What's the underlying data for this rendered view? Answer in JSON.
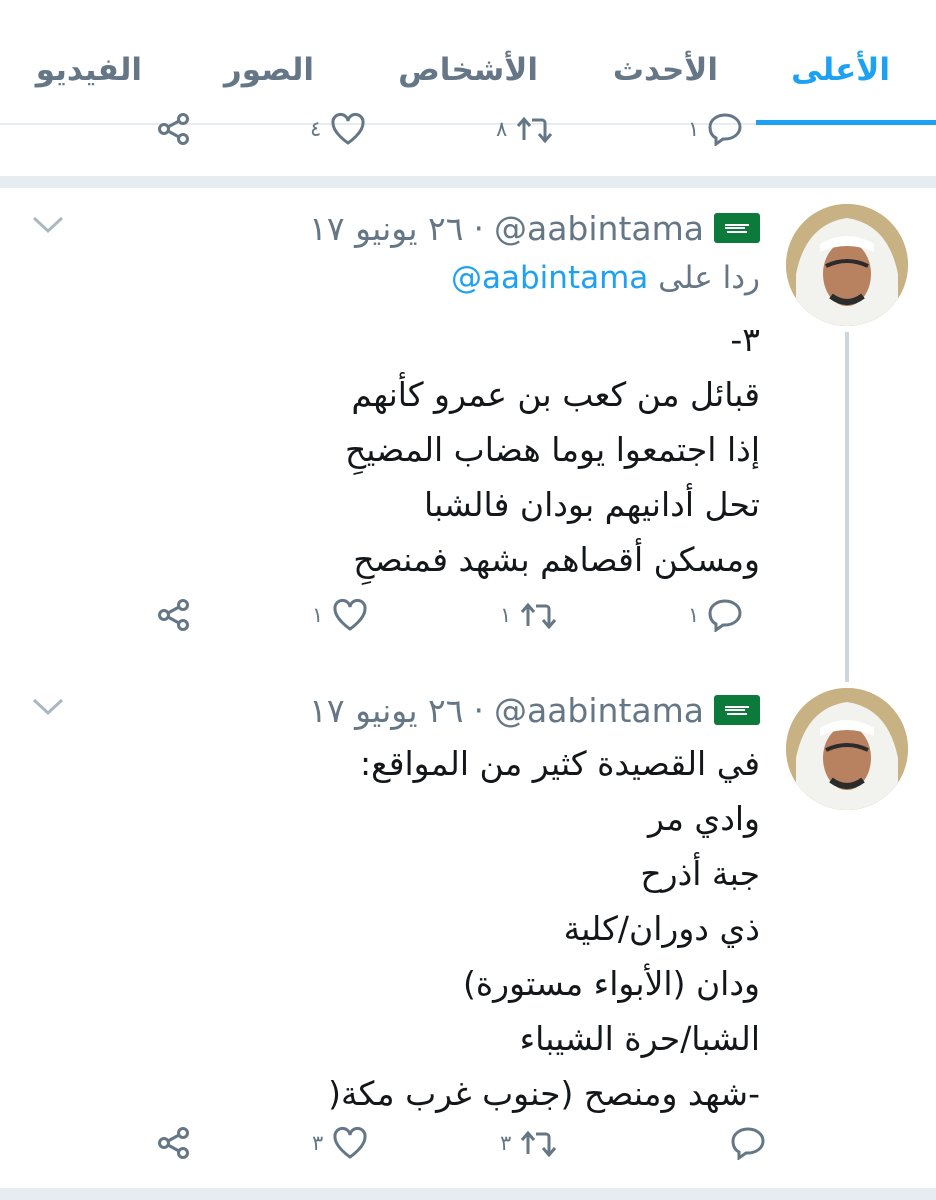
{
  "tabs": [
    {
      "label": "الأعلى",
      "active": true
    },
    {
      "label": "الأحدث",
      "active": false
    },
    {
      "label": "الأشخاص",
      "active": false
    },
    {
      "label": "الصور",
      "active": false
    },
    {
      "label": "الفيديو",
      "active": false
    }
  ],
  "prev_tweet": {
    "reply_count": "١",
    "retweet_count": "٨",
    "like_count": "٤"
  },
  "tweets": [
    {
      "handle": "@aabintama",
      "date": "٢٦ يونيو ١٧",
      "separator": "·",
      "reply_prefix": "ردا على",
      "reply_to": "@aabintama",
      "lines": [
        "٣-",
        "قبائل من كعب بن عمرو كأنهم",
        "إذا اجتمعوا يوما هضاب المضيحِ",
        "تحل أدانيهم بودان فالشبا",
        "ومسكن أقصاهم بشهد فمنصحِ"
      ],
      "reply_count": "١",
      "retweet_count": "١",
      "like_count": "١"
    },
    {
      "handle": "@aabintama",
      "date": "٢٦ يونيو ١٧",
      "separator": "·",
      "lines": [
        "في القصيدة كثير من المواقع:",
        "وادي مر",
        "جبة أذرح",
        "ذي دوران/كلية",
        "ودان (الأبواء مستورة)",
        "الشبا/حرة الشيباء",
        "-شهد ومنصح (جنوب غرب مكة("
      ],
      "reply_count": "",
      "retweet_count": "٣",
      "like_count": "٣"
    }
  ],
  "colors": {
    "accent": "#1da1f2",
    "muted": "#657786",
    "separator": "#e6ecf0",
    "flag_green": "#0c7a3b"
  },
  "icons": [
    "reply-icon",
    "retweet-icon",
    "like-icon",
    "share-icon",
    "chevron-down-icon",
    "saudi-flag-icon"
  ]
}
